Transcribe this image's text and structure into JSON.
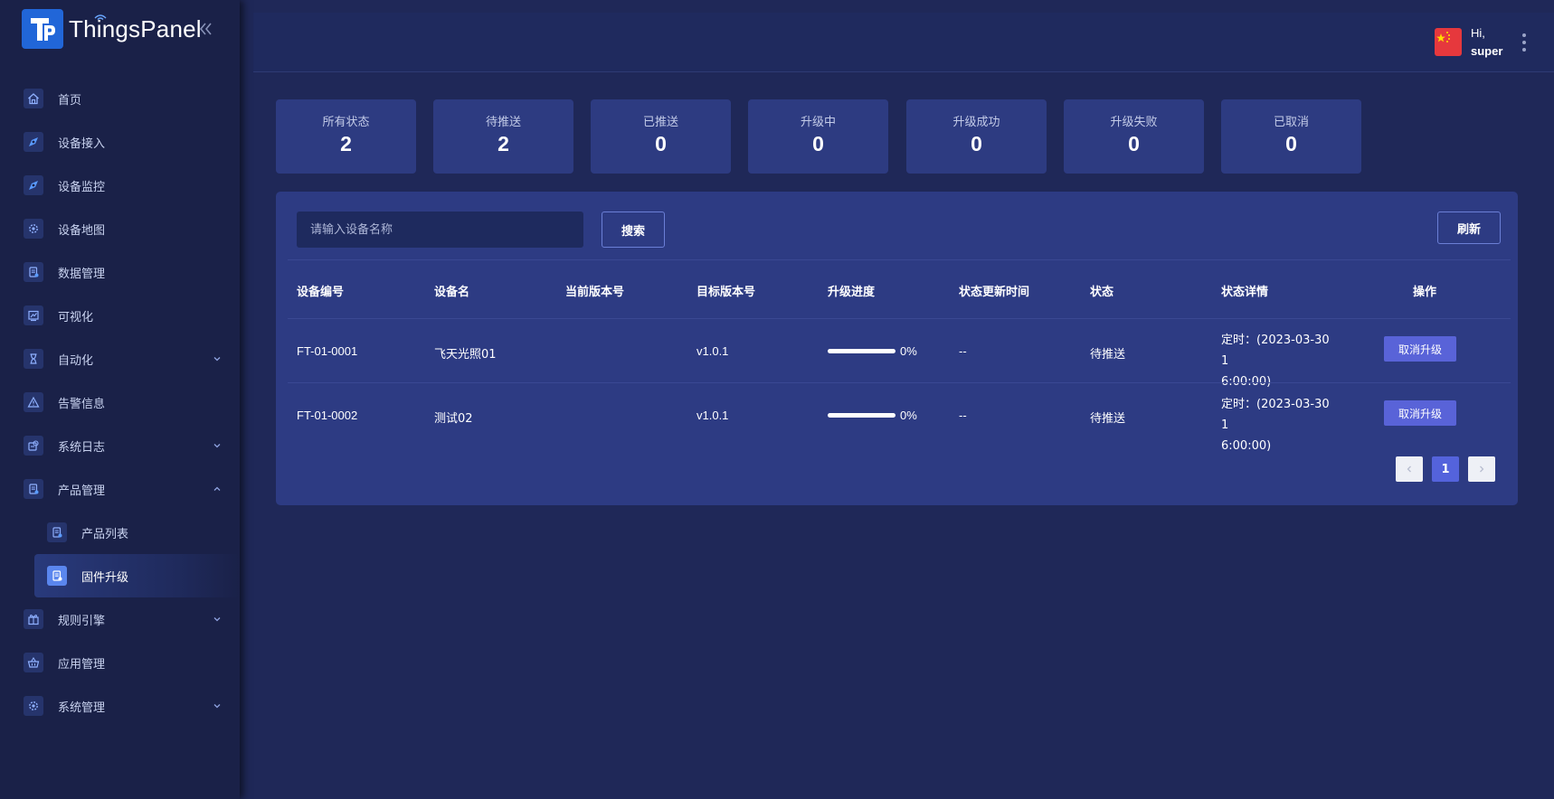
{
  "app": {
    "name": "ThingsPanel"
  },
  "sidebar": {
    "items": [
      {
        "label": "首页",
        "icon": "home-icon"
      },
      {
        "label": "设备接入",
        "icon": "device-access-icon"
      },
      {
        "label": "设备监控",
        "icon": "device-monitor-icon"
      },
      {
        "label": "设备地图",
        "icon": "map-gear-icon"
      },
      {
        "label": "数据管理",
        "icon": "data-clipboard-icon"
      },
      {
        "label": "可视化",
        "icon": "chart-icon"
      },
      {
        "label": "自动化",
        "icon": "hourglass-icon",
        "expandable": true
      },
      {
        "label": "告警信息",
        "icon": "warning-icon"
      },
      {
        "label": "系统日志",
        "icon": "log-icon",
        "expandable": true
      },
      {
        "label": "产品管理",
        "icon": "product-clipboard-icon",
        "expanded": true
      },
      {
        "label": "产品列表",
        "icon": "clipboard-icon",
        "sub": true
      },
      {
        "label": "固件升级",
        "icon": "clipboard-icon",
        "sub": true,
        "active": true
      },
      {
        "label": "规则引擎",
        "icon": "gift-icon",
        "expandable": true
      },
      {
        "label": "应用管理",
        "icon": "basket-icon"
      },
      {
        "label": "系统管理",
        "icon": "settings-icon",
        "expandable": true
      }
    ]
  },
  "header": {
    "greeting": "Hi,",
    "username": "super",
    "flag": "china-flag-icon"
  },
  "stats": [
    {
      "label": "所有状态",
      "value": "2"
    },
    {
      "label": "待推送",
      "value": "2"
    },
    {
      "label": "已推送",
      "value": "0"
    },
    {
      "label": "升级中",
      "value": "0"
    },
    {
      "label": "升级成功",
      "value": "0"
    },
    {
      "label": "升级失败",
      "value": "0"
    },
    {
      "label": "已取消",
      "value": "0"
    }
  ],
  "toolbar": {
    "search_placeholder": "请输入设备名称",
    "search_value": "",
    "search_label": "搜索",
    "refresh_label": "刷新"
  },
  "table": {
    "columns": [
      "设备编号",
      "设备名",
      "当前版本号",
      "目标版本号",
      "升级进度",
      "状态更新时间",
      "状态",
      "状态详情",
      "操作"
    ],
    "rows": [
      {
        "device_id": "FT-01-0001",
        "device_name": "飞天光照01",
        "current_version": "",
        "target_version": "v1.0.1",
        "progress": 0,
        "progress_text": "0%",
        "updated_at": "--",
        "status": "待推送",
        "detail_line1": "定时：(2023-03-30 1",
        "detail_line2": "6:00:00)",
        "action": "取消升级"
      },
      {
        "device_id": "FT-01-0002",
        "device_name": "测试02",
        "current_version": "",
        "target_version": "v1.0.1",
        "progress": 0,
        "progress_text": "0%",
        "updated_at": "--",
        "status": "待推送",
        "detail_line1": "定时：(2023-03-30 1",
        "detail_line2": "6:00:00)",
        "action": "取消升级"
      }
    ]
  },
  "pagination": {
    "current_page": "1"
  },
  "colors": {
    "background": "#1f2858",
    "sidebar": "#1a2148",
    "card": "#2d3b83",
    "accent": "#5963d8",
    "logo": "#2166d8"
  }
}
